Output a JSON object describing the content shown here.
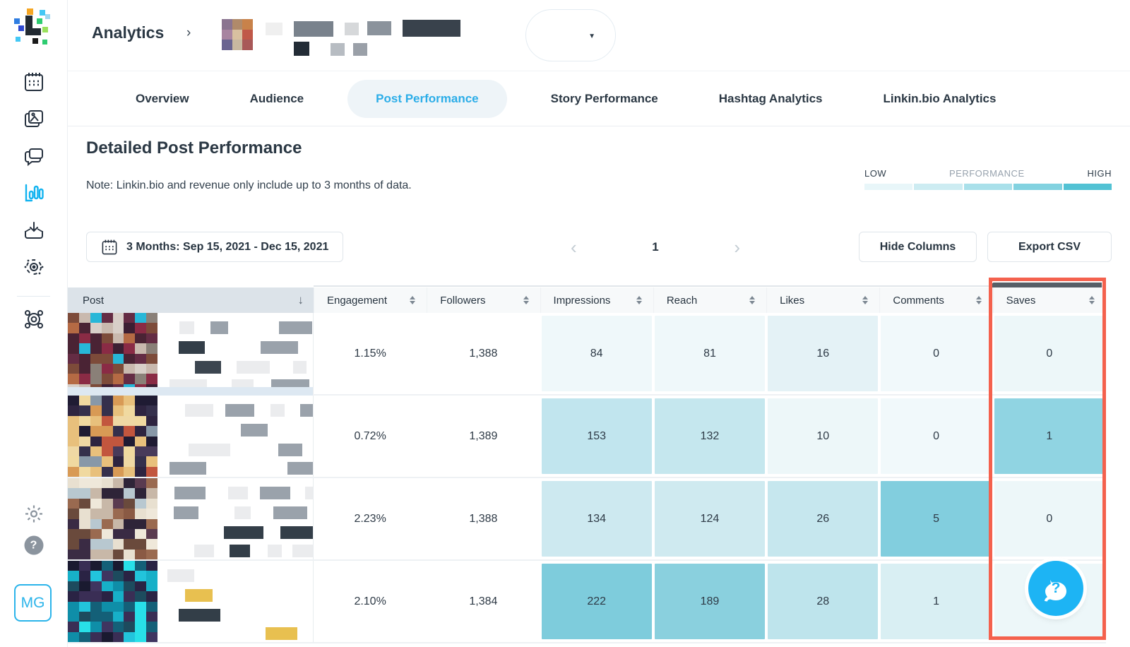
{
  "app": {
    "name": "Later"
  },
  "sidebar": {
    "items": [
      {
        "name": "calendar",
        "active": false
      },
      {
        "name": "media",
        "active": false
      },
      {
        "name": "conversations",
        "active": false
      },
      {
        "name": "analytics",
        "active": true
      },
      {
        "name": "collect",
        "active": false
      },
      {
        "name": "monitor",
        "active": false
      },
      {
        "name": "groups",
        "active": false
      }
    ],
    "help_label": "?",
    "avatar_initials": "MG",
    "active_color": "#12b3f0"
  },
  "header": {
    "breadcrumb": "Analytics",
    "chevron": "›",
    "account_caret": "▼",
    "account_avatar_palette": [
      "#8a7490",
      "#b08a6a",
      "#c8824a",
      "#a884a0",
      "#d8c0a0",
      "#c05848",
      "#6a6490",
      "#c8b8a0",
      "#a85858"
    ]
  },
  "tabs": {
    "items": [
      {
        "label": "Overview",
        "active": false
      },
      {
        "label": "Audience",
        "active": false
      },
      {
        "label": "Post Performance",
        "active": true
      },
      {
        "label": "Story Performance",
        "active": false
      },
      {
        "label": "Hashtag Analytics",
        "active": false
      },
      {
        "label": "Linkin.bio Analytics",
        "active": false
      }
    ],
    "active_color": "#2bade8",
    "active_bg": "#eef4f8"
  },
  "page": {
    "title": "Detailed Post Performance",
    "note": "Note: Linkin.bio and revenue only include up to 3 months of data."
  },
  "legend": {
    "low": "LOW",
    "label": "PERFORMANCE",
    "high": "HIGH",
    "colors": [
      "#e8f6f9",
      "#cdecf2",
      "#a9e0ea",
      "#82d2e0",
      "#52c2d4"
    ]
  },
  "controls": {
    "date_range": "3 Months: Sep 15, 2021 - Dec 15, 2021",
    "prev": "‹",
    "page": "1",
    "next": "›",
    "hide_columns": "Hide Columns",
    "export_csv": "Export CSV"
  },
  "table": {
    "post_header": "Post",
    "post_sort_arrow": "↓",
    "columns": [
      "Engagement",
      "Followers",
      "Impressions",
      "Reach",
      "Likes",
      "Comments",
      "Saves"
    ],
    "highlighted_column": "Saves",
    "highlight_color": "#f4614d",
    "rows": [
      {
        "post": {
          "palette": [
            "#4a2334",
            "#7d4b3a",
            "#b56a44",
            "#d8cfc8",
            "#8a2b45",
            "#27b7d8",
            "#642c44",
            "#c9b9ae",
            "#3c1f33",
            "#8a8078"
          ],
          "accents": [
            "#3c4650"
          ],
          "strip": true
        },
        "cells": [
          {
            "v": "1.15%",
            "bg": ""
          },
          {
            "v": "1,388",
            "bg": ""
          },
          {
            "v": "84",
            "bg": "#eff8fa"
          },
          {
            "v": "81",
            "bg": "#eff8fa"
          },
          {
            "v": "16",
            "bg": "#e4f2f6"
          },
          {
            "v": "0",
            "bg": "#f1f9fb"
          },
          {
            "v": "0",
            "bg": "#edf7f9"
          }
        ]
      },
      {
        "post": {
          "palette": [
            "#2e2440",
            "#483a5a",
            "#e8c07c",
            "#f0d9a0",
            "#1f1b33",
            "#d89a55",
            "#c2563e",
            "#8898a8",
            "#35304c",
            "#efd8a4"
          ],
          "accents": [
            "#1f7a1f",
            "#5ec94e"
          ],
          "strip": false
        },
        "cells": [
          {
            "v": "0.72%",
            "bg": ""
          },
          {
            "v": "1,389",
            "bg": ""
          },
          {
            "v": "153",
            "bg": "#c1e5ee"
          },
          {
            "v": "132",
            "bg": "#c5e7ee"
          },
          {
            "v": "10",
            "bg": "#edf7f9"
          },
          {
            "v": "0",
            "bg": "#f1f9fb"
          },
          {
            "v": "1",
            "bg": "#90d4e2"
          }
        ]
      },
      {
        "post": {
          "palette": [
            "#5a3b50",
            "#8a5a44",
            "#e8e0d0",
            "#3a2b44",
            "#9a6a50",
            "#c8b8a8",
            "#2e2438",
            "#b8c8d0",
            "#6a4a3c",
            "#efe8da"
          ],
          "accents": [],
          "strip": false
        },
        "cells": [
          {
            "v": "2.23%",
            "bg": ""
          },
          {
            "v": "1,388",
            "bg": ""
          },
          {
            "v": "134",
            "bg": "#cde9f0"
          },
          {
            "v": "124",
            "bg": "#cfeaf0"
          },
          {
            "v": "26",
            "bg": "#c6e7ee"
          },
          {
            "v": "5",
            "bg": "#82cede"
          },
          {
            "v": "0",
            "bg": "#edf7f9"
          }
        ]
      },
      {
        "post": {
          "palette": [
            "#2a2344",
            "#1d4b5e",
            "#17b0c8",
            "#28e0e8",
            "#3a2e55",
            "#146078",
            "#22c4dc",
            "#1a1a30",
            "#3f3560",
            "#0f8ea8"
          ],
          "accents": [
            "#e8c050"
          ],
          "strip": false
        },
        "cells": [
          {
            "v": "2.10%",
            "bg": ""
          },
          {
            "v": "1,384",
            "bg": ""
          },
          {
            "v": "222",
            "bg": "#7eccdc"
          },
          {
            "v": "189",
            "bg": "#8ad0de"
          },
          {
            "v": "28",
            "bg": "#bee4ec"
          },
          {
            "v": "1",
            "bg": "#d9eff3"
          },
          {
            "v": "",
            "bg": "#edf7f9"
          }
        ]
      }
    ]
  },
  "help_bubble": {
    "icon": "question-chat",
    "color": "#1db4f4"
  }
}
